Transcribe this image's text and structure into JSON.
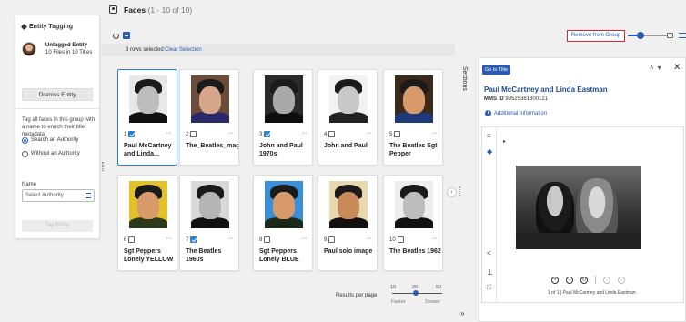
{
  "left_panel": {
    "title": "Entity Tagging",
    "entity_name": "Untagged Entity",
    "entity_meta": "10 Files in 10 Titles",
    "dismiss_label": "Dismiss Entity",
    "description": "Tag all faces in this group with a name to enrich their title metadata",
    "radio_search": "Search an Authority",
    "radio_without": "Without an Authority",
    "name_label": "Name",
    "select_placeholder": "Select Authority",
    "tag_button": "Tag Entity"
  },
  "header": {
    "title": "Faces",
    "count": "(1 - 10 of 10)",
    "rows_selected": "3 rows selected",
    "clear_selection": "Clear Selection",
    "remove_from_group": "Remove from Group"
  },
  "cards": [
    {
      "num": "1",
      "checked": true,
      "title": "Paul McCartney and Linda...",
      "selected": true
    },
    {
      "num": "2",
      "checked": false,
      "title": "The_Beatles_magical_mystery_...",
      "selected": false
    },
    {
      "num": "3",
      "checked": true,
      "title": "John and Paul 1970s",
      "selected": false
    },
    {
      "num": "4",
      "checked": false,
      "title": "John and Paul",
      "selected": false
    },
    {
      "num": "5",
      "checked": false,
      "title": "The Beatles Sgt Pepper",
      "selected": false
    },
    {
      "num": "6",
      "checked": false,
      "title": "Sgt Peppers Lonely YELLOW",
      "selected": false
    },
    {
      "num": "7",
      "checked": true,
      "title": "The Beatles 1960s",
      "selected": false
    },
    {
      "num": "8",
      "checked": false,
      "title": "Sgt Peppers Lonely BLUE",
      "selected": false
    },
    {
      "num": "9",
      "checked": false,
      "title": "Paul solo image",
      "selected": false
    },
    {
      "num": "10",
      "checked": false,
      "title": "The Beatles 1962",
      "selected": false
    }
  ],
  "card_more": "···",
  "pagination": {
    "label": "Results per page",
    "options": [
      "10",
      "20",
      "50"
    ],
    "faster": "Faster",
    "slower": "Slower"
  },
  "sections_label": "Sections",
  "right_panel": {
    "goto_title": "Go to Title",
    "title": "Paul McCartney and Linda Eastman",
    "mms_label": "MMS ID",
    "mms_id": "9952538180012​1",
    "additional_info": "Additional Information",
    "caption": "1 of 1 | Paul McCartney and Linda Eastman"
  },
  "colors": {
    "accent": "#2a5db0",
    "highlight": "#d92b2b",
    "card_select": "#2a7fd4"
  }
}
